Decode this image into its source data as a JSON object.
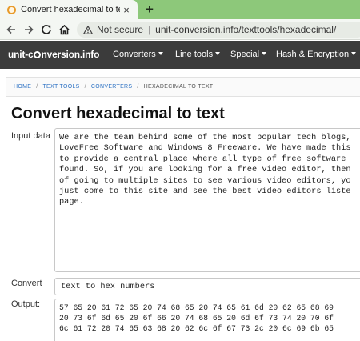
{
  "browser": {
    "tab_title": "Convert hexadecimal to text - Co",
    "tab_close": "×",
    "new_tab": "+",
    "security_label": "Not secure",
    "separator": "|",
    "url": "unit-conversion.info/texttools/hexadecimal/"
  },
  "site": {
    "logo_part1": "unit-c",
    "logo_part2": "nversion.info",
    "nav": [
      {
        "label": "Converters"
      },
      {
        "label": "Line tools"
      },
      {
        "label": "Special"
      },
      {
        "label": "Hash & Encryption"
      }
    ]
  },
  "breadcrumb": {
    "items": [
      "HOME",
      "TEXT TOOLS",
      "CONVERTERS"
    ],
    "current": "HEXADECIMAL TO TEXT",
    "separator": "/"
  },
  "page": {
    "title": "Convert hexadecimal to text"
  },
  "form": {
    "input_label": "Input data",
    "input_lines": [
      "We are the team behind some of the most popular tech blogs,",
      "LoveFree Software and Windows 8 Freeware. We have made this",
      "to provide a central place where all type of free software",
      "found. So, if you are looking for a free video editor, then",
      "of going to multiple sites to see various video editors, yo",
      "just come to this site and see the best video editors liste",
      "page."
    ],
    "convert_label": "Convert",
    "convert_value": "text to hex numbers",
    "output_label": "Output:",
    "output_lines": [
      "57 65 20 61 72 65 20 74 68 65 20 74 65 61 6d 20 62 65 68 69",
      "20 73 6f 6d 65 20 6f 66 20 74 68 65 20 6d 6f 73 74 20 70 6f",
      "6c 61 72 20 74 65 63 68 20 62 6c 6f 67 73 2c 20 6c 69 6b 65"
    ]
  }
}
